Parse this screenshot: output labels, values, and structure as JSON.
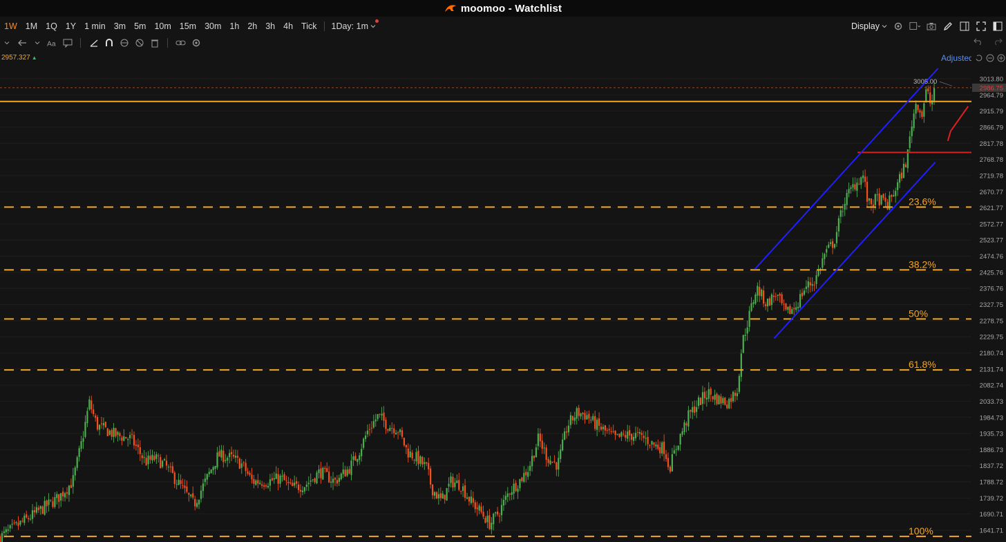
{
  "window": {
    "title": "moomoo - Watchlist"
  },
  "toolbar": {
    "periods": [
      "1W",
      "1M",
      "1Q",
      "1Y",
      "1 min",
      "3m",
      "5m",
      "10m",
      "15m",
      "30m",
      "1h",
      "2h",
      "3h",
      "4h",
      "Tick"
    ],
    "active_period": "1W",
    "interval_dropdown": "1Day: 1m",
    "display_label": "Display"
  },
  "chart_header": {
    "current_value": "2957.327",
    "adjust_label": "Adjusted"
  },
  "colors": {
    "background": "#141414",
    "up": "#4caf50",
    "down": "#f4511e",
    "fib": "#f5a623",
    "channel": "#1f1fff",
    "resistance": "#e02020",
    "accent": "#ff8a1f"
  },
  "chart_data": {
    "type": "candlestick",
    "y_axis_ticks": [
      "3013.80",
      "2964.79",
      "2915.79",
      "2866.79",
      "2817.78",
      "2768.78",
      "2719.78",
      "2670.77",
      "2621.77",
      "2572.77",
      "2523.77",
      "2474.76",
      "2425.76",
      "2376.76",
      "2327.75",
      "2278.75",
      "2229.75",
      "2180.74",
      "2131.74",
      "2082.74",
      "2033.73",
      "1984.73",
      "1935.73",
      "1886.73",
      "1837.72",
      "1788.72",
      "1739.72",
      "1690.71",
      "1641.71"
    ],
    "last_price_label": "2986.75",
    "high_label": "3005.00",
    "ylim": [
      1620,
      3040
    ],
    "support_line": 2945,
    "fib_levels": [
      {
        "label": "23.6%",
        "value": 2624
      },
      {
        "label": "38.2%",
        "value": 2433
      },
      {
        "label": "50%",
        "value": 2284
      },
      {
        "label": "61.8%",
        "value": 2129
      },
      {
        "label": "100%",
        "value": 1623
      }
    ],
    "resistance_level": 2790,
    "channel": {
      "upper": [
        [
          0.778,
          2435
        ],
        [
          0.967,
          3035
        ]
      ],
      "lower": [
        [
          0.798,
          2225
        ],
        [
          0.964,
          2760
        ]
      ]
    },
    "close_path": [
      [
        0.0,
        1620
      ],
      [
        0.02,
        1660
      ],
      [
        0.04,
        1700
      ],
      [
        0.06,
        1740
      ],
      [
        0.075,
        1790
      ],
      [
        0.085,
        1920
      ],
      [
        0.092,
        2030
      ],
      [
        0.1,
        1960
      ],
      [
        0.12,
        1930
      ],
      [
        0.135,
        1920
      ],
      [
        0.15,
        1850
      ],
      [
        0.16,
        1860
      ],
      [
        0.17,
        1840
      ],
      [
        0.18,
        1800
      ],
      [
        0.19,
        1760
      ],
      [
        0.2,
        1720
      ],
      [
        0.21,
        1780
      ],
      [
        0.225,
        1870
      ],
      [
        0.24,
        1860
      ],
      [
        0.25,
        1840
      ],
      [
        0.26,
        1790
      ],
      [
        0.275,
        1790
      ],
      [
        0.29,
        1800
      ],
      [
        0.3,
        1770
      ],
      [
        0.315,
        1780
      ],
      [
        0.33,
        1820
      ],
      [
        0.345,
        1790
      ],
      [
        0.36,
        1830
      ],
      [
        0.37,
        1880
      ],
      [
        0.38,
        1950
      ],
      [
        0.39,
        1990
      ],
      [
        0.4,
        1960
      ],
      [
        0.41,
        1950
      ],
      [
        0.42,
        1880
      ],
      [
        0.43,
        1860
      ],
      [
        0.44,
        1830
      ],
      [
        0.445,
        1770
      ],
      [
        0.455,
        1730
      ],
      [
        0.465,
        1790
      ],
      [
        0.475,
        1780
      ],
      [
        0.485,
        1730
      ],
      [
        0.495,
        1700
      ],
      [
        0.505,
        1660
      ],
      [
        0.515,
        1700
      ],
      [
        0.525,
        1760
      ],
      [
        0.535,
        1790
      ],
      [
        0.545,
        1830
      ],
      [
        0.555,
        1920
      ],
      [
        0.565,
        1860
      ],
      [
        0.575,
        1840
      ],
      [
        0.585,
        1960
      ],
      [
        0.595,
        2000
      ],
      [
        0.605,
        1990
      ],
      [
        0.615,
        1960
      ],
      [
        0.625,
        1940
      ],
      [
        0.635,
        1920
      ],
      [
        0.645,
        1930
      ],
      [
        0.655,
        1930
      ],
      [
        0.665,
        1920
      ],
      [
        0.675,
        1900
      ],
      [
        0.685,
        1890
      ],
      [
        0.69,
        1830
      ],
      [
        0.7,
        1920
      ],
      [
        0.71,
        1990
      ],
      [
        0.72,
        2030
      ],
      [
        0.73,
        2060
      ],
      [
        0.74,
        2040
      ],
      [
        0.75,
        2030
      ],
      [
        0.76,
        2070
      ],
      [
        0.765,
        2210
      ],
      [
        0.772,
        2290
      ],
      [
        0.78,
        2380
      ],
      [
        0.79,
        2330
      ],
      [
        0.8,
        2360
      ],
      [
        0.81,
        2300
      ],
      [
        0.82,
        2320
      ],
      [
        0.83,
        2380
      ],
      [
        0.84,
        2400
      ],
      [
        0.85,
        2480
      ],
      [
        0.86,
        2520
      ],
      [
        0.87,
        2640
      ],
      [
        0.88,
        2690
      ],
      [
        0.89,
        2720
      ],
      [
        0.895,
        2630
      ],
      [
        0.905,
        2650
      ],
      [
        0.915,
        2630
      ],
      [
        0.925,
        2690
      ],
      [
        0.935,
        2770
      ],
      [
        0.94,
        2880
      ],
      [
        0.945,
        2950
      ],
      [
        0.95,
        2900
      ],
      [
        0.955,
        2980
      ],
      [
        0.96,
        2930
      ],
      [
        0.963,
        2987
      ]
    ]
  }
}
